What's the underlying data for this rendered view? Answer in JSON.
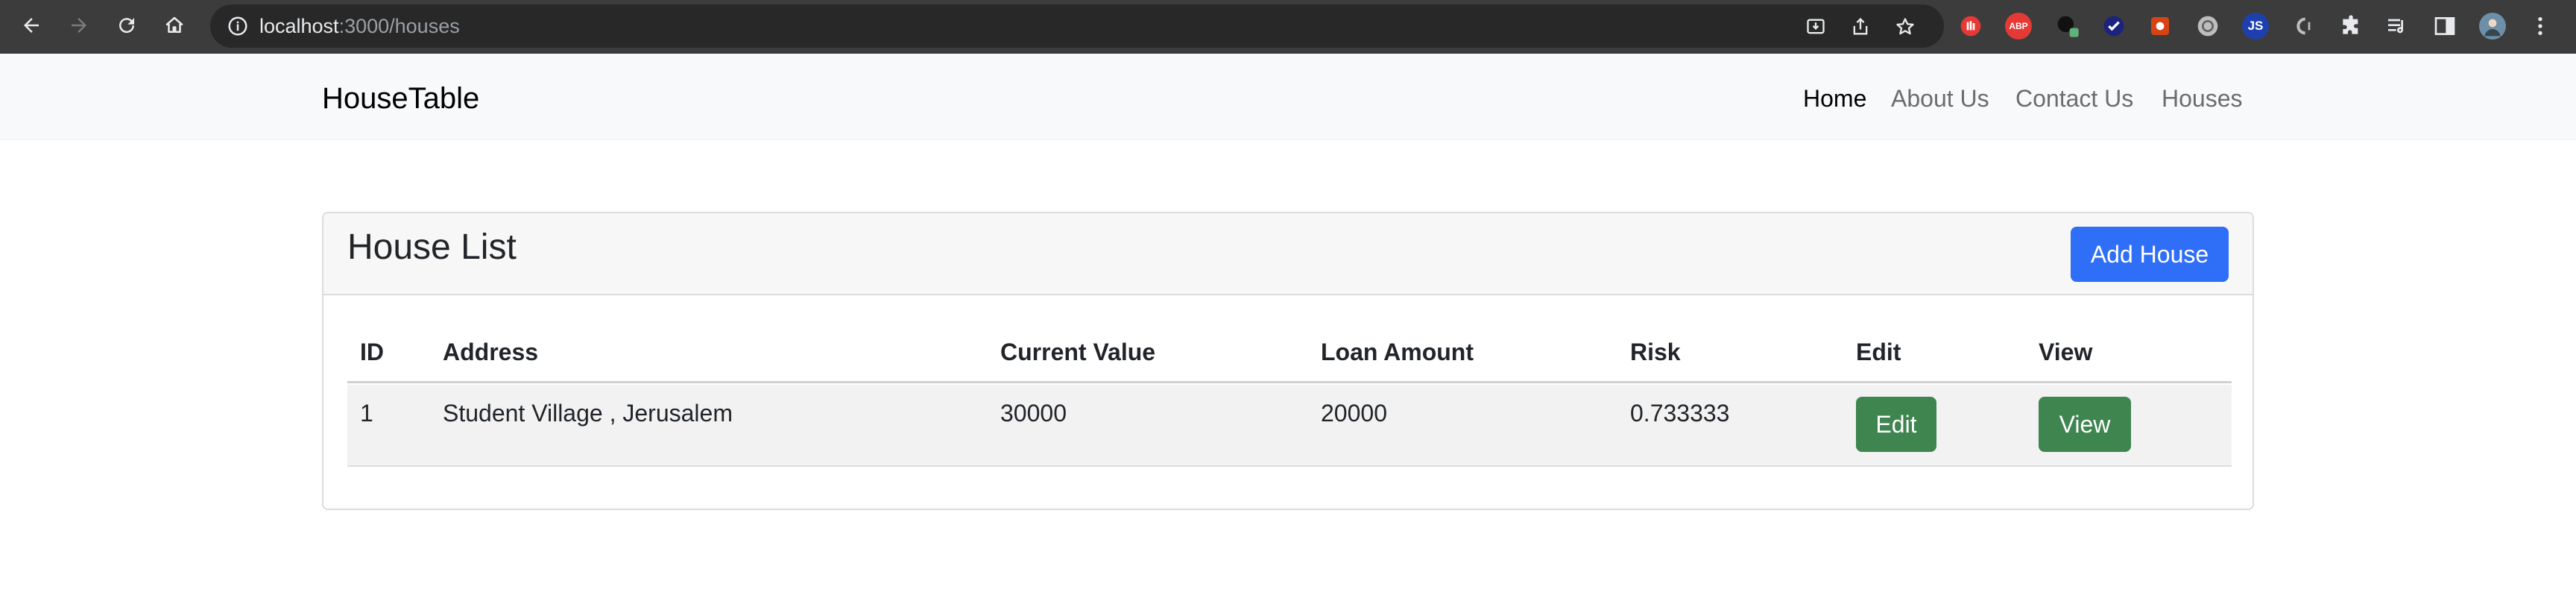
{
  "browser": {
    "url_host": "localhost",
    "url_path": ":3000/houses",
    "icons": [
      "back-icon",
      "forward-icon",
      "reload-icon",
      "home-icon",
      "info-icon",
      "install-icon",
      "share-icon",
      "star-icon",
      "puzzle-icon",
      "media-icon",
      "sidepanel-icon",
      "profile-icon",
      "kebab-menu-icon"
    ],
    "extensions": {
      "abp": "ABP",
      "js": "JS"
    }
  },
  "navbar": {
    "brand": "HouseTable",
    "links": [
      {
        "label": "Home",
        "active": true
      },
      {
        "label": "About Us",
        "active": false
      },
      {
        "label": "Contact Us",
        "active": false
      },
      {
        "label": "Houses",
        "active": false
      }
    ]
  },
  "card": {
    "title": "House List",
    "add_button": "Add House"
  },
  "table": {
    "columns": [
      "ID",
      "Address",
      "Current Value",
      "Loan Amount",
      "Risk",
      "Edit",
      "View"
    ],
    "rows": [
      {
        "id": "1",
        "address": "Student Village , Jerusalem",
        "current_value": "30000",
        "loan_amount": "20000",
        "risk": "0.733333",
        "edit_label": "Edit",
        "view_label": "View"
      }
    ]
  },
  "colors": {
    "primary": "#2f6ef6",
    "success": "#3f8550",
    "chrome": "#3c3c3c"
  }
}
